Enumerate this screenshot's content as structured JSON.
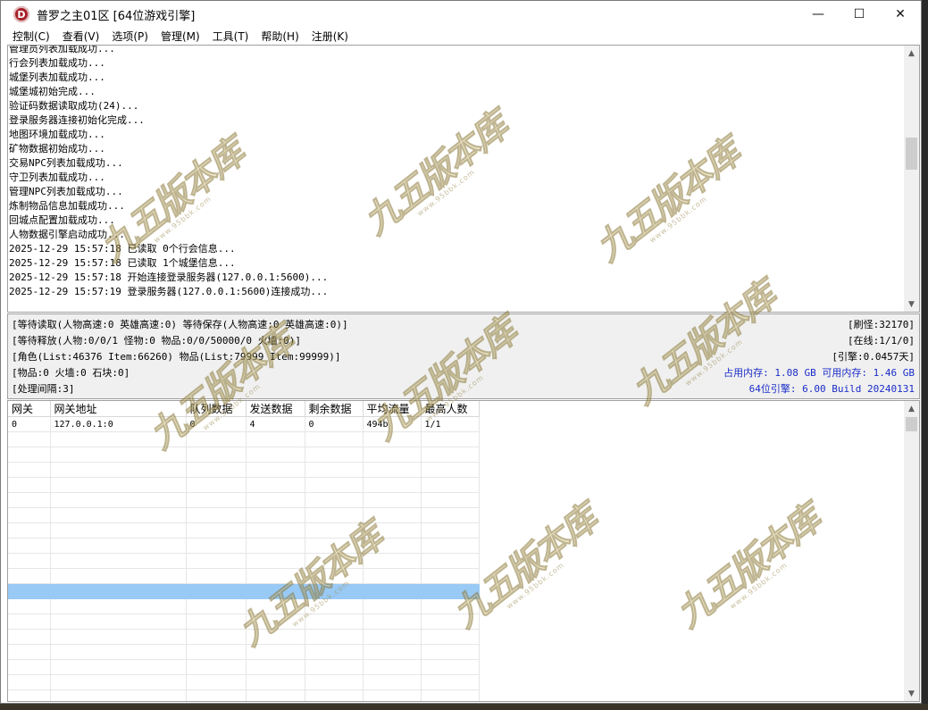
{
  "window": {
    "title": "普罗之主01区 [64位游戏引擎]",
    "icon_letter": "D"
  },
  "controls": {
    "minimize": "—",
    "maximize": "☐",
    "close": "✕"
  },
  "menu": [
    "控制(C)",
    "查看(V)",
    "选项(P)",
    "管理(M)",
    "工具(T)",
    "帮助(H)",
    "注册(K)"
  ],
  "log": {
    "lines": [
      "管理员列表加载成功...",
      "行会列表加载成功...",
      "城堡列表加载成功...",
      "城堡城初始完成...",
      "验证码数据读取成功(24)...",
      "登录服务器连接初始化完成...",
      "地图环境加载成功...",
      "矿物数据初始成功...",
      "交易NPC列表加载成功...",
      "守卫列表加载成功...",
      "管理NPC列表加载成功...",
      "炼制物品信息加载成功...",
      "回城点配置加载成功...",
      "人物数据引擎启动成功...",
      "2025-12-29 15:57:18 已读取 0个行会信息...",
      "2025-12-29 15:57:18 已读取 1个城堡信息...",
      "2025-12-29 15:57:18 开始连接登录服务器(127.0.0.1:5600)...",
      "2025-12-29 15:57:19 登录服务器(127.0.0.1:5600)连接成功..."
    ]
  },
  "status": {
    "left": [
      "[等待读取(人物高速:0 英雄高速:0) 等待保存(人物高速:0 英雄高速:0)]",
      "[等待释放(人物:0/0/1 怪物:0 物品:0/0/50000/0 火墙:0)]",
      "[角色(List:46376 Item:66260) 物品(List:79999 Item:99999)]",
      "[物品:0 火墙:0 石块:0]",
      "[处理间隔:3]"
    ],
    "right": [
      "[刷怪:32170]",
      "[在线:1/1/0]",
      "[引擎:0.0457天]",
      "占用内存: 1.08 GB 可用内存: 1.46 GB",
      "64位引擎: 6.00 Build 20240131"
    ],
    "blue_color": "#1a2cc9"
  },
  "gateway_table": {
    "headers": [
      "网关",
      "网关地址",
      "队列数据",
      "发送数据",
      "剩余数据",
      "平均流量",
      "最高人数"
    ],
    "rows": [
      [
        "0",
        "127.0.0.1:0",
        "0",
        "4",
        "0",
        "494b",
        "1/1"
      ]
    ],
    "selection_color": "#99c9f5"
  },
  "watermark": {
    "text": "九五版本库",
    "sub": "www.95bbk.com"
  }
}
